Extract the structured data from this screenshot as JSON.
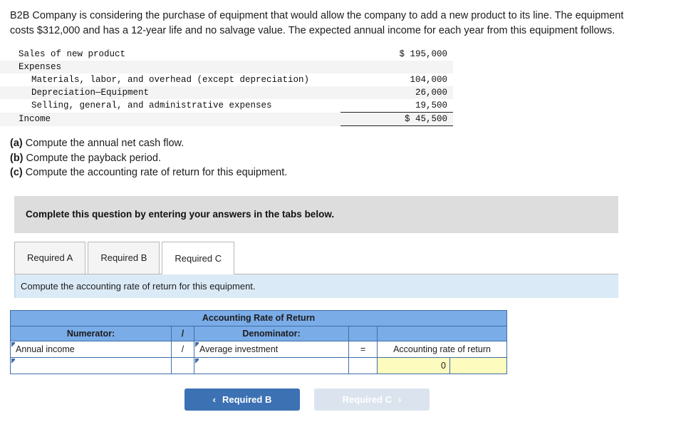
{
  "problem": {
    "statement": "B2B Company is considering the purchase of equipment that would allow the company to add a new product to its line. The equipment costs $312,000 and has a 12-year life and no salvage value. The expected annual income for each year from this equipment follows."
  },
  "income_statement": {
    "rows": [
      {
        "label": "Sales of new product",
        "amount": "$ 195,000",
        "indent": false,
        "striped": false,
        "rule": "none"
      },
      {
        "label": "Expenses",
        "amount": "",
        "indent": false,
        "striped": true,
        "rule": "none"
      },
      {
        "label": "Materials, labor, and overhead (except depreciation)",
        "amount": "104,000",
        "indent": true,
        "striped": false,
        "rule": "none"
      },
      {
        "label": "Depreciation—Equipment",
        "amount": "26,000",
        "indent": true,
        "striped": true,
        "rule": "none"
      },
      {
        "label": "Selling, general, and administrative expenses",
        "amount": "19,500",
        "indent": true,
        "striped": false,
        "rule": "none"
      },
      {
        "label": "Income",
        "amount": "$ 45,500",
        "indent": false,
        "striped": true,
        "rule": "double"
      }
    ]
  },
  "requirements": [
    {
      "key": "(a)",
      "text": "Compute the annual net cash flow."
    },
    {
      "key": "(b)",
      "text": "Compute the payback period."
    },
    {
      "key": "(c)",
      "text": "Compute the accounting rate of return for this equipment."
    }
  ],
  "instruction_banner": {
    "text": "Complete this question by entering your answers in the tabs below."
  },
  "tabs": [
    {
      "label": "Required A",
      "active": false
    },
    {
      "label": "Required B",
      "active": false
    },
    {
      "label": "Required C",
      "active": true
    }
  ],
  "sub_instruction": {
    "text": "Compute the accounting rate of return for this equipment."
  },
  "arr_table": {
    "title": "Accounting Rate of Return",
    "header": {
      "numerator": "Numerator:",
      "slash": "/",
      "denominator": "Denominator:"
    },
    "formula_row": {
      "numerator": "Annual income",
      "slash": "/",
      "denominator": "Average investment",
      "equals": "=",
      "result_label": "Accounting rate of return"
    },
    "answer_row": {
      "numerator_value": "",
      "slash": "",
      "denominator_value": "",
      "equals": "",
      "result_value": "0",
      "result_suffix": ""
    }
  },
  "nav_buttons": {
    "prev": {
      "label": "Required B",
      "icon": "chevron-left-icon",
      "glyph": "‹",
      "enabled": true
    },
    "next": {
      "label": "Required C",
      "icon": "chevron-right-icon",
      "glyph": "›",
      "enabled": false
    }
  },
  "colors": {
    "primary_blue": "#3c71b4",
    "table_header_blue": "#7aace8",
    "table_border_blue": "#3f6fa8",
    "instruction_gray": "#dddddd",
    "sub_instruction_blue": "#dbeaf7",
    "answer_yellow": "#fdfbbe"
  }
}
